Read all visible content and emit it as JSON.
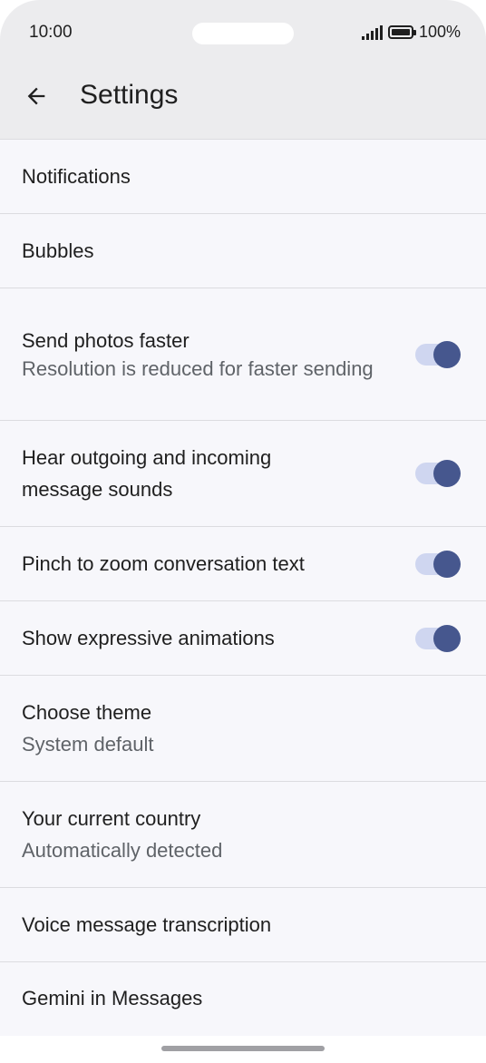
{
  "status_bar": {
    "time": "10:00",
    "battery": "100%",
    "icons": [
      "signal-icon",
      "battery-icon"
    ]
  },
  "header": {
    "title": "Settings",
    "back_icon": "arrow-back-icon"
  },
  "settings": [
    {
      "primary": "Notifications",
      "secondary": "",
      "toggle": false
    },
    {
      "primary": "Bubbles",
      "secondary": "",
      "toggle": false
    },
    {
      "primary": "Send photos faster",
      "secondary": "Resolution is reduced for faster sending",
      "toggle": true,
      "on": true
    },
    {
      "primary": "Hear outgoing and incoming message sounds",
      "secondary": "",
      "toggle": true,
      "on": true
    },
    {
      "primary": "Pinch to zoom conversation text",
      "secondary": "",
      "toggle": true,
      "on": true
    },
    {
      "primary": "Show expressive animations",
      "secondary": "",
      "toggle": true,
      "on": true
    },
    {
      "primary": "Choose theme",
      "secondary": "System default",
      "toggle": false
    },
    {
      "primary": "Your current country",
      "secondary": "Automatically detected",
      "toggle": false
    },
    {
      "primary": "Voice message transcription",
      "secondary": "",
      "toggle": false
    },
    {
      "primary": "Gemini in Messages",
      "secondary": "",
      "toggle": false
    }
  ],
  "colors": {
    "toggle_thumb": "#46578e",
    "toggle_track": "#cfd6f0",
    "background": "#f7f7fb",
    "app_bar": "#ececee"
  }
}
